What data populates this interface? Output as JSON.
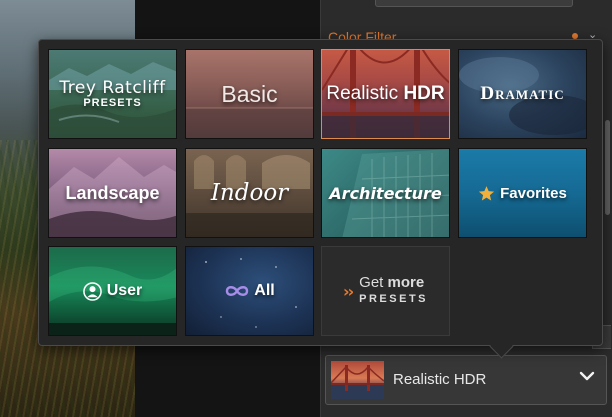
{
  "right_panel": {
    "section_title": "Color Filter"
  },
  "preset_selector": {
    "selected": "Realistic HDR"
  },
  "presets": {
    "trey": {
      "name": "Trey Ratcliff",
      "sub": "PRESETS"
    },
    "basic": "Basic",
    "realistic_hdr": {
      "prefix": "Realistic",
      "bold": "HDR"
    },
    "dramatic": "Dramatic",
    "landscape": "Landscape",
    "indoor": "Indoor",
    "architecture": "Architecture",
    "favorites": "Favorites",
    "user": "User",
    "all": "All",
    "get_more": {
      "line1_prefix": "Get",
      "line1_bold": "more",
      "line2": "PRESETS"
    }
  },
  "icons": {
    "favorites": "star-icon",
    "user": "user-icon",
    "all": "infinity-icon",
    "get_more": "double-chevron-icon",
    "dropdown": "chevron-down-icon"
  },
  "colors": {
    "accent": "#e0772f",
    "selected_border": "#e08a4a",
    "star": "#f2b03a"
  }
}
